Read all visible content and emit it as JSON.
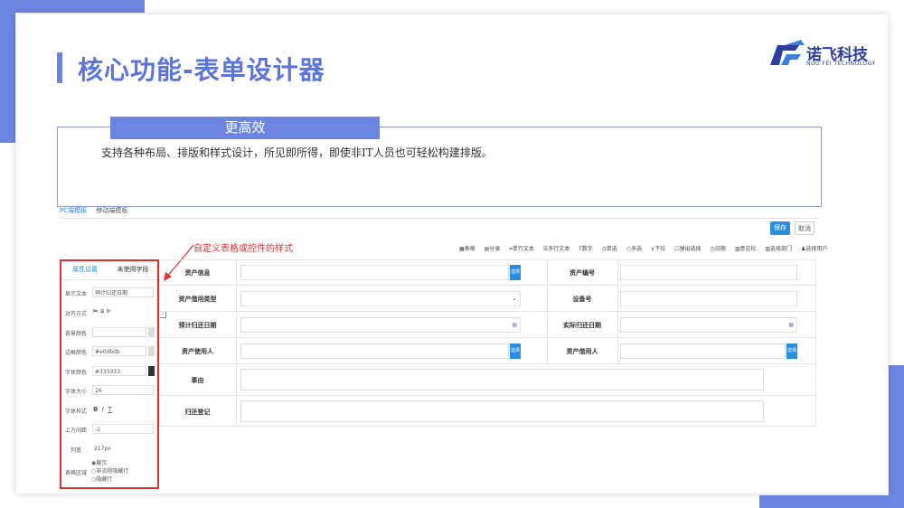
{
  "slide": {
    "title": "核心功能-表单设计器",
    "logo": {
      "name": "诺飞科技",
      "subtitle": "NUO FEI TECHNOLOGY"
    }
  },
  "feature": {
    "tag": "更高效",
    "text": "支持各种布局、排版和样式设计，所见即所得，即使非IT人员也可轻松构建排版。"
  },
  "designer": {
    "tabs": [
      "PC端模板",
      "移动端模板"
    ],
    "save_label": "保存",
    "cancel_label": "取消",
    "annotation": "自定义表格或控件的样式",
    "toolbar": [
      "表格",
      "分录",
      "单行文本",
      "多行文本",
      "数字",
      "单选",
      "多选",
      "下拉",
      "弹出选择",
      "日期",
      "意见栏",
      "选择部门",
      "选择用户"
    ],
    "panel": {
      "tabs": [
        "属性设置",
        "未使用字段"
      ],
      "rows": [
        {
          "label": "显示文本",
          "value": "预计归还日期"
        },
        {
          "label": "对齐方式",
          "value": ""
        },
        {
          "label": "背景颜色",
          "value": ""
        },
        {
          "label": "边框颜色",
          "value": "#e0dbdb"
        },
        {
          "label": "字体颜色",
          "value": "#333333"
        },
        {
          "label": "字体大小",
          "value": "16"
        },
        {
          "label": "字体样式",
          "value": ""
        },
        {
          "label": "上方间距",
          "value": "-1"
        },
        {
          "label": "列宽",
          "value": "217px"
        },
        {
          "label": "表格区域",
          "value": ""
        }
      ],
      "font_style_glyphs": [
        "B",
        "I",
        "T"
      ],
      "radios": [
        "展示",
        "非流程隐藏行",
        "隐藏行"
      ]
    },
    "form": {
      "rows": [
        {
          "left": "资产信息",
          "right": "资产编号"
        },
        {
          "left": "资产借用类型",
          "right": "设备号"
        },
        {
          "left": "预计归还日期",
          "right": "实际归还日期"
        },
        {
          "left": "资产使用人",
          "right": "资产借用人"
        },
        {
          "left": "事由",
          "right": ""
        },
        {
          "left": "归还登记",
          "right": ""
        }
      ],
      "select_label": "选择"
    }
  },
  "colors": {
    "accent": "#6b85e0",
    "brand_blue": "#2a8ee0",
    "annotation_red": "#e03030"
  }
}
